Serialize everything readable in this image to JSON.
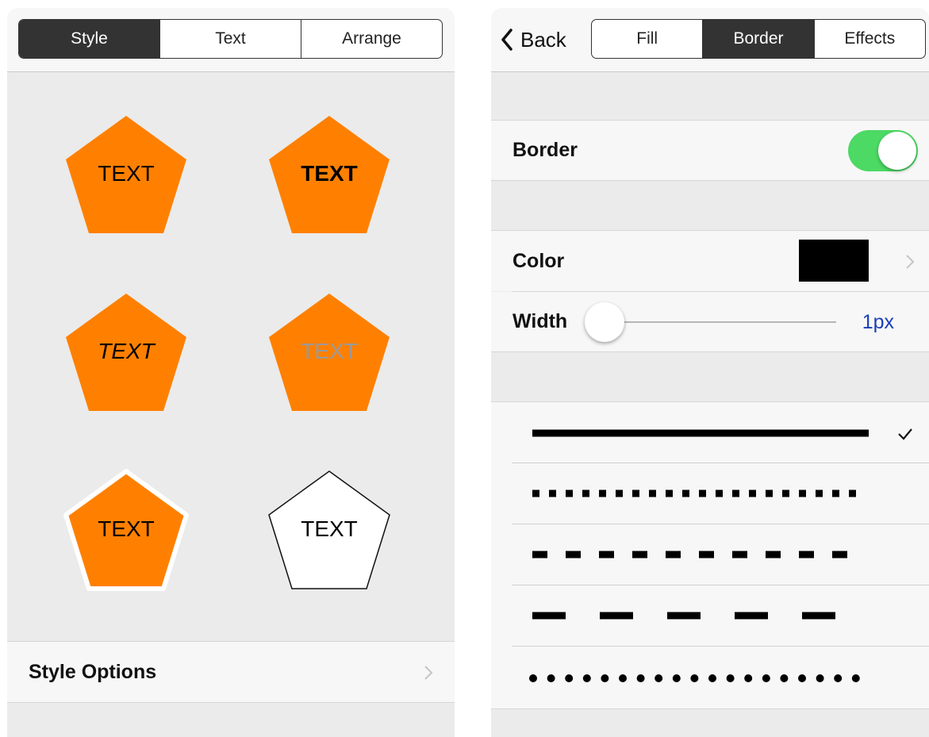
{
  "left": {
    "tabs": [
      {
        "label": "Style",
        "active": true
      },
      {
        "label": "Text",
        "active": false
      },
      {
        "label": "Arrange",
        "active": false
      }
    ],
    "styles": [
      {
        "text": "TEXT",
        "variant": "normal",
        "fill": "#ff8000"
      },
      {
        "text": "TEXT",
        "variant": "bold",
        "fill": "#ff8000"
      },
      {
        "text": "TEXT",
        "variant": "italic",
        "fill": "#ff8000"
      },
      {
        "text": "TEXT",
        "variant": "gray",
        "fill": "#ff8000"
      },
      {
        "text": "TEXT",
        "variant": "white-border",
        "fill": "#ff8000"
      },
      {
        "text": "TEXT",
        "variant": "outline",
        "fill": "#ffffff"
      }
    ],
    "style_options_label": "Style Options"
  },
  "right": {
    "back_label": "Back",
    "tabs": [
      {
        "label": "Fill",
        "active": false
      },
      {
        "label": "Border",
        "active": true
      },
      {
        "label": "Effects",
        "active": false
      }
    ],
    "border_label": "Border",
    "border_enabled": true,
    "color_label": "Color",
    "color_value": "#000000",
    "width_label": "Width",
    "width_value": "1px",
    "line_styles": [
      {
        "name": "solid",
        "selected": true
      },
      {
        "name": "square-dot",
        "selected": false
      },
      {
        "name": "dash",
        "selected": false
      },
      {
        "name": "long-dash",
        "selected": false
      },
      {
        "name": "round-dot",
        "selected": false
      }
    ]
  },
  "colors": {
    "accent_orange": "#ff8000",
    "toggle_green": "#4cd964",
    "value_blue": "#1a3fb8",
    "segment_dark": "#333333"
  }
}
